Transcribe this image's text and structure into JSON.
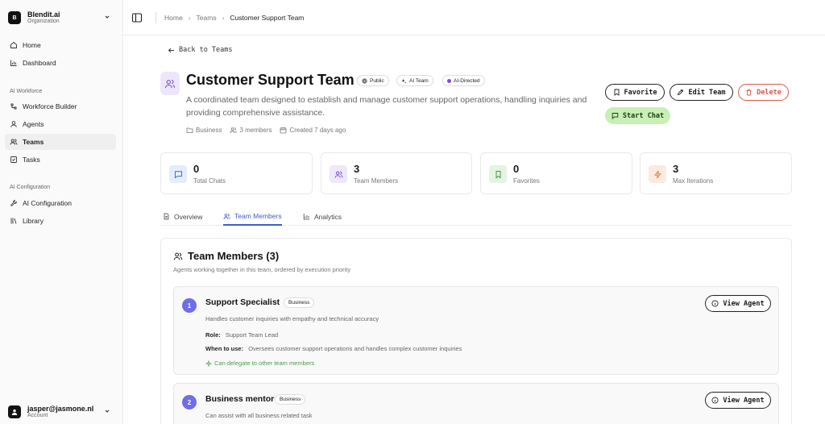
{
  "sidebar": {
    "org_initial": "B",
    "org_name": "Blendit.ai",
    "org_sub": "Organization",
    "items_main": [
      {
        "label": "Home",
        "icon": "home-icon"
      },
      {
        "label": "Dashboard",
        "icon": "chart-icon"
      }
    ],
    "section_workforce": "AI Workforce",
    "items_workforce": [
      {
        "label": "Workforce Builder",
        "icon": "workflow-icon"
      },
      {
        "label": "Agents",
        "icon": "agents-icon"
      },
      {
        "label": "Teams",
        "icon": "users-icon",
        "active": true
      },
      {
        "label": "Tasks",
        "icon": "tasks-icon"
      }
    ],
    "section_config": "AI Configuration",
    "items_config": [
      {
        "label": "AI Configuration",
        "icon": "wrench-icon"
      },
      {
        "label": "Library",
        "icon": "library-icon"
      }
    ],
    "account_email": "jasper@jasmone.nl",
    "account_sub": "Account"
  },
  "breadcrumb": [
    "Home",
    "Teams",
    "Customer Support Team"
  ],
  "back_label": "Back to Teams",
  "team": {
    "title": "Customer Support Team",
    "badges": [
      "Public",
      "AI Team",
      "AI-Directed"
    ],
    "description": "A coordinated team designed to establish and manage customer support operations, handling inquiries and providing comprehensive assistance.",
    "category": "Business",
    "members": "3 members",
    "created": "Created 7 days ago"
  },
  "actions": {
    "favorite": "Favorite",
    "edit": "Edit Team",
    "delete": "Delete",
    "start_chat": "Start Chat"
  },
  "stats": [
    {
      "value": "0",
      "label": "Total Chats",
      "icon": "chat-icon"
    },
    {
      "value": "3",
      "label": "Team Members",
      "icon": "users-icon"
    },
    {
      "value": "0",
      "label": "Favorites",
      "icon": "bookmark-icon"
    },
    {
      "value": "3",
      "label": "Max Iterations",
      "icon": "bolt-icon"
    }
  ],
  "tabs": [
    "Overview",
    "Team Members",
    "Analytics"
  ],
  "members_panel": {
    "title": "Team Members (3)",
    "subtitle": "Agents working together in this team, ordered by execution priority",
    "role_label": "Role:",
    "when_label": "When to use:",
    "view_label": "View Agent",
    "members": [
      {
        "num": "1",
        "name": "Support Specialist",
        "category": "Business",
        "description": "Handles customer inquiries with empathy and technical accuracy",
        "role": "Support Team Lead",
        "when": "Oversees customer support operations and handles complex customer inquiries",
        "delegate": "Can delegate to other team members"
      },
      {
        "num": "2",
        "name": "Business mentor",
        "category": "Business",
        "description": "Can assist with all business related task"
      }
    ]
  },
  "colors": {
    "accent_blue": "#3d5fc9",
    "delete_red": "#d65a4a",
    "chat_green": "#c8efb4",
    "member_number": "#6d6ee8"
  }
}
